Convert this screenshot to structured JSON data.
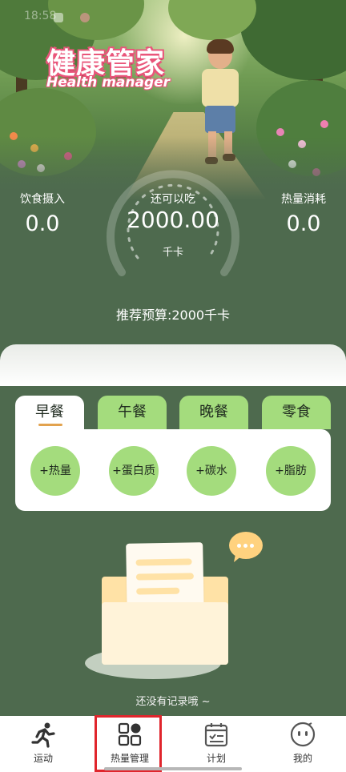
{
  "status_bar": {
    "time": "18:58"
  },
  "header": {
    "logo_cn": "健康管家",
    "logo_en": "Health manager"
  },
  "stats": {
    "intake_label": "饮食摄入",
    "intake_value": "0.0",
    "remaining_label": "还可以吃",
    "remaining_value": "2000.00",
    "remaining_unit": "千卡",
    "burned_label": "热量消耗",
    "burned_value": "0.0",
    "budget_text": "推荐预算:2000千卡"
  },
  "meal_tabs": [
    {
      "label": "早餐",
      "active": true
    },
    {
      "label": "午餐",
      "active": false
    },
    {
      "label": "晚餐",
      "active": false
    },
    {
      "label": "零食",
      "active": false
    }
  ],
  "nutrient_buttons": [
    "+热量",
    "+蛋白质",
    "+碳水",
    "+脂肪"
  ],
  "empty_state": {
    "text": "还没有记录哦 ~"
  },
  "bottom_nav": [
    {
      "label": "运动",
      "icon": "runner-icon"
    },
    {
      "label": "热量管理",
      "icon": "grid-icon",
      "active": true
    },
    {
      "label": "计划",
      "icon": "calendar-check-icon"
    },
    {
      "label": "我的",
      "icon": "face-icon"
    }
  ],
  "colors": {
    "background": "#4e6a4e",
    "tab_green": "#a4dc7d",
    "logo_pink": "#e9557a",
    "highlight_red": "#e0252c"
  }
}
